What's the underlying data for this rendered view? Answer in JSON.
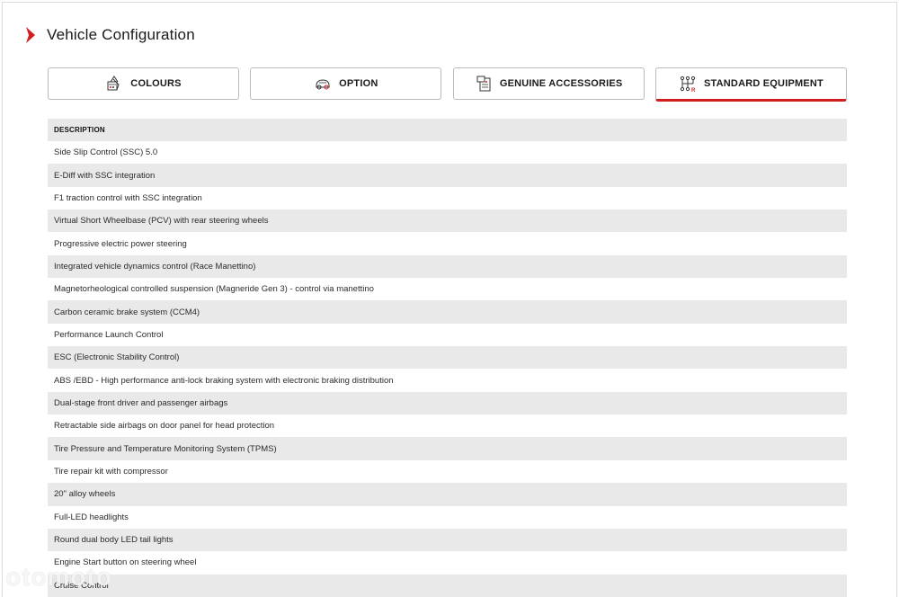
{
  "header": {
    "title": "Vehicle Configuration"
  },
  "tabs": [
    {
      "label": "COLOURS",
      "icon": "colour-palette-icon",
      "active": false
    },
    {
      "label": "OPTION",
      "icon": "option-car-icon",
      "active": false
    },
    {
      "label": "GENUINE ACCESSORIES",
      "icon": "accessories-icon",
      "active": false
    },
    {
      "label": "STANDARD EQUIPMENT",
      "icon": "gear-shift-icon",
      "active": true
    }
  ],
  "table": {
    "header": "DESCRIPTION",
    "rows": [
      "Side Slip Control (SSC) 5.0",
      "E-Diff with SSC integration",
      "F1 traction control with SSC integration",
      "Virtual Short Wheelbase (PCV) with rear steering wheels",
      "Progressive electric power steering",
      "Integrated vehicle dynamics control (Race Manettino)",
      "Magnetorheological controlled suspension (Magneride Gen 3) - control via manettino",
      "Carbon ceramic brake system (CCM4)",
      "Performance Launch Control",
      "ESC (Electronic Stability Control)",
      "ABS /EBD - High performance anti-lock braking system with electronic braking distribution",
      "Dual-stage front driver and passenger airbags",
      "Retractable side airbags on door panel for head protection",
      "Tire Pressure and Temperature Monitoring System (TPMS)",
      "Tire repair kit with compressor",
      "20\" alloy wheels",
      "Full-LED headlights",
      "Round dual body LED tail lights",
      "Engine Start button on steering wheel",
      "Cruise Control"
    ]
  },
  "watermark": "otomoto",
  "colors": {
    "accent": "#d11f1f",
    "row_shade": "#e9e9e9"
  }
}
